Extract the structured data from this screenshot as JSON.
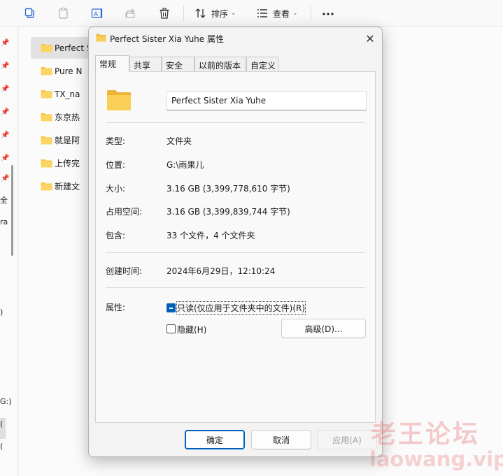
{
  "toolbar": {
    "sort_label": "排序",
    "view_label": "查看"
  },
  "nav": {
    "fragments": [
      "全",
      "ra",
      ")",
      "G:)",
      "(",
      "("
    ]
  },
  "files": {
    "items": [
      {
        "name": "Perfect Sister Xia Yuhe"
      },
      {
        "name": "Pure N"
      },
      {
        "name": "TX_na"
      },
      {
        "name": "东京热"
      },
      {
        "name": "就是阿"
      },
      {
        "name": "上传完"
      },
      {
        "name": "新建文"
      }
    ]
  },
  "dialog": {
    "title": "Perfect Sister Xia Yuhe 属性",
    "close_glyph": "✕",
    "tabs": [
      {
        "label": "常规"
      },
      {
        "label": "共享"
      },
      {
        "label": "安全"
      },
      {
        "label": "以前的版本"
      },
      {
        "label": "自定义"
      }
    ],
    "folder_name": "Perfect Sister Xia Yuhe",
    "rows": {
      "type": {
        "label": "类型:",
        "value": "文件夹"
      },
      "location": {
        "label": "位置:",
        "value": "G:\\雨果儿"
      },
      "size": {
        "label": "大小:",
        "value": "3.16 GB (3,399,778,610 字节)"
      },
      "disk_size": {
        "label": "占用空间:",
        "value": "3.16 GB (3,399,839,744 字节)"
      },
      "contains": {
        "label": "包含:",
        "value": "33 个文件，4 个文件夹"
      },
      "created": {
        "label": "创建时间:",
        "value": "2024年6月29日，12:10:24"
      }
    },
    "attributes": {
      "label": "属性:",
      "readonly_label": "只读(仅应用于文件夹中的文件)(R)",
      "hidden_label": "隐藏(H)",
      "advanced_label": "高级(D)..."
    },
    "buttons": {
      "ok": "确定",
      "cancel": "取消",
      "apply": "应用(A)"
    }
  },
  "watermark": {
    "cn": "老王论坛",
    "en": "laowang.vip"
  },
  "colors": {
    "accent": "#005fb8",
    "folder": "#f8c84a",
    "watermark": "#e46060"
  }
}
